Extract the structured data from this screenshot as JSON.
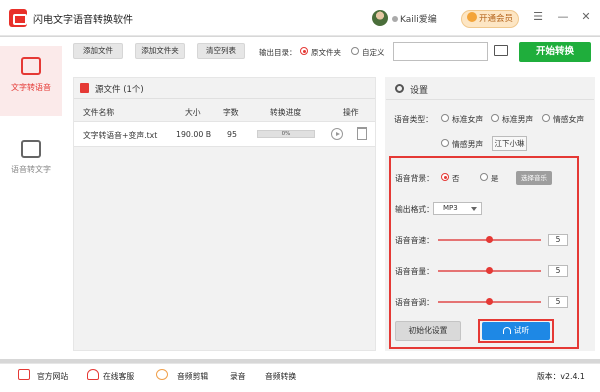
{
  "app": {
    "title": "闪电文字语音转换软件"
  },
  "user": {
    "name": "Kaili爱编",
    "vip_label": "开通会员"
  },
  "sidebar": {
    "items": [
      {
        "label": "文字转语音",
        "active": true
      },
      {
        "label": "语音转文字",
        "active": false
      }
    ]
  },
  "toolbar": {
    "add_file": "添加文件",
    "add_folder": "添加文件夹",
    "clear_list": "清空列表",
    "output_label": "输出目录：",
    "output_options": [
      "原文件夹",
      "自定义"
    ],
    "output_selected": "原文件夹",
    "path_value": "",
    "start_label": "开始转换"
  },
  "file_panel": {
    "title": "源文件 (1个)",
    "columns": [
      "文件名称",
      "大小",
      "字数",
      "转换进度",
      "操作"
    ],
    "rows": [
      {
        "name": "文字转语音+变声.txt",
        "size": "190.00 B",
        "chars": "95",
        "progress": "0%"
      }
    ]
  },
  "settings": {
    "title": "设置",
    "voice_type_label": "语音类型：",
    "voice_options": [
      "标准女声",
      "标准男声",
      "情感女声",
      "情感男声"
    ],
    "voice_badge": "江下小琳",
    "bg_label": "语音背景：",
    "bg_options": [
      "否",
      "是"
    ],
    "bg_selected": "否",
    "music_button": "选择音乐",
    "format_label": "输出格式：",
    "format_value": "MP3",
    "speed_label": "语音音速：",
    "speed_value": "5",
    "volume_label": "语音音量：",
    "volume_value": "5",
    "pitch_label": "语音音调：",
    "pitch_value": "5",
    "slider_fraction": 0.5,
    "reset_button": "初始化设置",
    "listen_button": "试听"
  },
  "bottom": {
    "website": "官方网站",
    "service": "在线客服",
    "audio_edit": "音频剪辑",
    "record": "录音",
    "audio_convert": "音频转换",
    "version": "版本：v2.4.1"
  },
  "colors": {
    "accent": "#e53935",
    "start": "#1fae3c",
    "listen": "#1e88e5"
  }
}
